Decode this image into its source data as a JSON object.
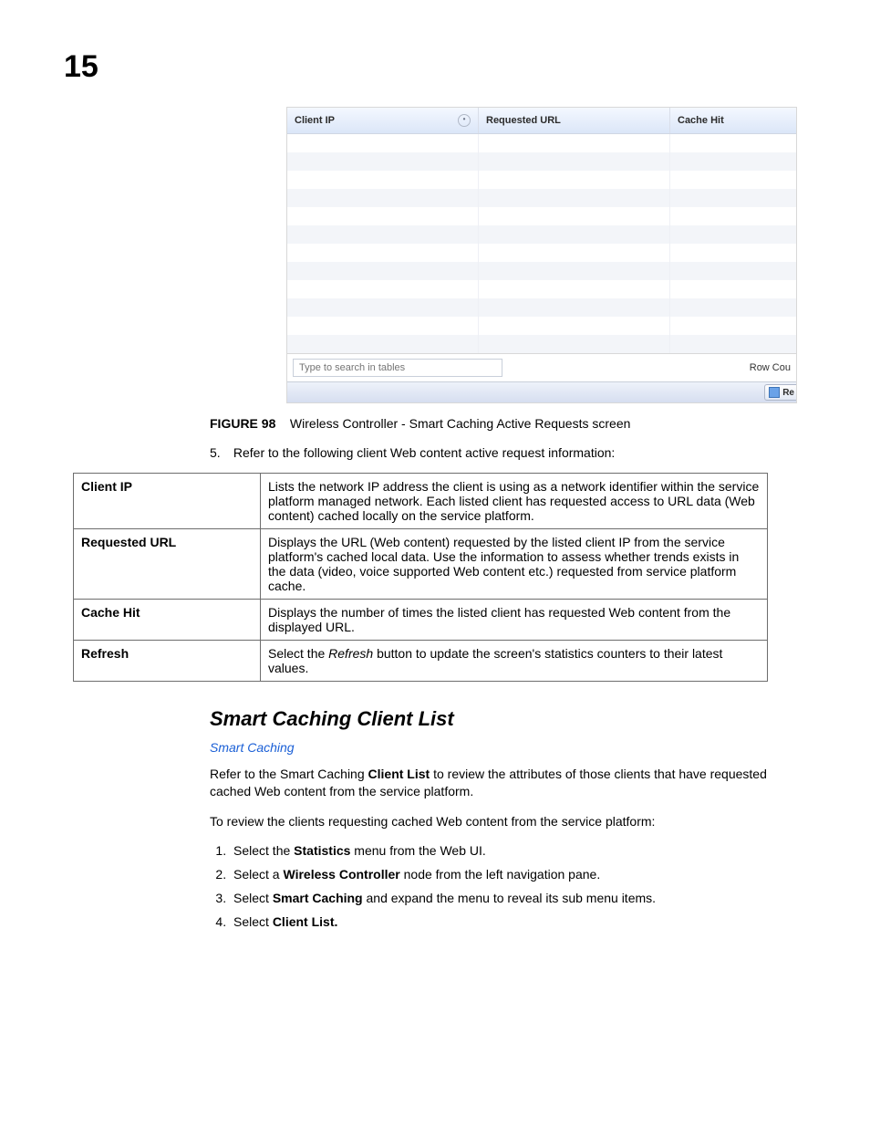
{
  "chapter_number": "15",
  "screenshot": {
    "columns": {
      "c1": "Client IP",
      "c2": "Requested URL",
      "c3": "Cache Hit"
    },
    "search_placeholder": "Type to search in tables",
    "row_count_label": "Row Cou",
    "refresh_btn": "Re"
  },
  "figure": {
    "label": "FIGURE 98",
    "caption": "Wireless Controller - Smart Caching Active Requests screen"
  },
  "lead_in": {
    "num": "5.",
    "text": "Refer to the following client Web content active request information:"
  },
  "info_table": [
    {
      "k": "Client IP",
      "v_plain": "Lists the network IP address the client is using as a network identifier within the service platform managed network. Each listed client has requested access to URL data (Web content) cached locally on the service platform."
    },
    {
      "k": "Requested URL",
      "v_plain": "Displays the URL (Web content) requested by the listed client IP from the service platform's cached local data. Use the information to assess whether trends exists in the data (video, voice supported Web content etc.) requested from service platform cache."
    },
    {
      "k": "Cache Hit",
      "v_plain": "Displays the number of times the listed client has requested Web content from the displayed URL."
    },
    {
      "k": "Refresh",
      "v_pre": "Select the ",
      "v_ital": "Refresh",
      "v_post": " button to update the screen's statistics counters to their latest values."
    }
  ],
  "section": {
    "heading": "Smart Caching Client List",
    "sub": "Smart Caching",
    "p1_pre": "Refer to the Smart Caching ",
    "p1_bold": "Client List",
    "p1_post": " to review the attributes of those clients that have requested cached Web content from the service platform.",
    "p2": "To review the clients requesting cached Web content from the service platform:",
    "steps": [
      {
        "pre": "Select the ",
        "bold": "Statistics",
        "post": " menu from the Web UI."
      },
      {
        "pre": "Select a ",
        "bold": "Wireless Controller",
        "post": " node from the left navigation pane."
      },
      {
        "pre": "Select ",
        "bold": "Smart Caching",
        "post": " and expand the menu to reveal its sub menu items."
      },
      {
        "pre": "Select ",
        "bold": "Client List.",
        "post": ""
      }
    ]
  }
}
